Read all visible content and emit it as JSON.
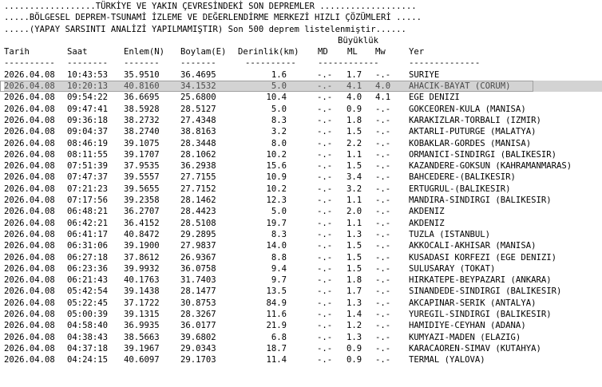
{
  "title_lines": [
    "..................TÜRKİYE VE YAKIN ÇEVRESİNDEKİ SON DEPREMLER ...................",
    ".....BÖLGESEL DEPREM-TSUNAMİ İZLEME VE DEĞERLENDİRME MERKEZİ HIZLI ÇÖZÜMLERİ .....",
    ".....(YAPAY SARSINTI ANALİZİ YAPILMAMIŞTIR) Son 500 deprem listelenmiştir......"
  ],
  "magnitude_group_label": "Büyüklük",
  "columns": {
    "date": "Tarih",
    "time": "Saat",
    "lat": "Enlem(N)",
    "lon": "Boylam(E)",
    "depth": "Derinlik(km)",
    "md": "MD",
    "ml": "ML",
    "mw": "Mw",
    "place": "Yer"
  },
  "separators": {
    "date": "----------",
    "time": "--------",
    "lat": "-------",
    "lon": "-------",
    "depth": "----------",
    "mags": "------------",
    "place": "--------------"
  },
  "selected_row_index": 1,
  "rows": [
    {
      "date": "2026.04.08",
      "time": "10:43:53",
      "lat": "35.9510",
      "lon": "36.4695",
      "depth": "1.6",
      "md": "-.-",
      "ml": "1.7",
      "mw": "-.-",
      "place": "SURIYE"
    },
    {
      "date": "2026.04.08",
      "time": "10:20:13",
      "lat": "40.8160",
      "lon": "34.1532",
      "depth": "5.0",
      "md": "-.-",
      "ml": "4.1",
      "mw": "4.0",
      "place": "AHACIK-BAYAT (CORUM)"
    },
    {
      "date": "2026.04.08",
      "time": "09:54:22",
      "lat": "36.6695",
      "lon": "25.6800",
      "depth": "10.4",
      "md": "-.-",
      "ml": "4.0",
      "mw": "4.1",
      "place": "EGE DENIZI"
    },
    {
      "date": "2026.04.08",
      "time": "09:47:41",
      "lat": "38.5928",
      "lon": "28.5127",
      "depth": "5.0",
      "md": "-.-",
      "ml": "0.9",
      "mw": "-.-",
      "place": "GOKCEOREN-KULA (MANISA)"
    },
    {
      "date": "2026.04.08",
      "time": "09:36:18",
      "lat": "38.2732",
      "lon": "27.4348",
      "depth": "8.3",
      "md": "-.-",
      "ml": "1.8",
      "mw": "-.-",
      "place": "KARAKIZLAR-TORBALI (IZMIR)"
    },
    {
      "date": "2026.04.08",
      "time": "09:04:37",
      "lat": "38.2740",
      "lon": "38.8163",
      "depth": "3.2",
      "md": "-.-",
      "ml": "1.5",
      "mw": "-.-",
      "place": "AKTARLI-PUTURGE (MALATYA)"
    },
    {
      "date": "2026.04.08",
      "time": "08:46:19",
      "lat": "39.1075",
      "lon": "28.3448",
      "depth": "8.0",
      "md": "-.-",
      "ml": "2.2",
      "mw": "-.-",
      "place": "KOBAKLAR-GORDES (MANISA)"
    },
    {
      "date": "2026.04.08",
      "time": "08:11:55",
      "lat": "39.1707",
      "lon": "28.1062",
      "depth": "10.2",
      "md": "-.-",
      "ml": "1.1",
      "mw": "-.-",
      "place": "ORMANICI-SINDIRGI (BALIKESIR)"
    },
    {
      "date": "2026.04.08",
      "time": "07:51:39",
      "lat": "37.9535",
      "lon": "36.2938",
      "depth": "15.6",
      "md": "-.-",
      "ml": "1.5",
      "mw": "-.-",
      "place": "KAZANDERE-GOKSUN (KAHRAMANMARAS)"
    },
    {
      "date": "2026.04.08",
      "time": "07:47:37",
      "lat": "39.5557",
      "lon": "27.7155",
      "depth": "10.9",
      "md": "-.-",
      "ml": "3.4",
      "mw": "-.-",
      "place": "BAHCEDERE-(BALIKESIR)"
    },
    {
      "date": "2026.04.08",
      "time": "07:21:23",
      "lat": "39.5655",
      "lon": "27.7152",
      "depth": "10.2",
      "md": "-.-",
      "ml": "3.2",
      "mw": "-.-",
      "place": "ERTUGRUL-(BALIKESIR)"
    },
    {
      "date": "2026.04.08",
      "time": "07:17:56",
      "lat": "39.2358",
      "lon": "28.1462",
      "depth": "12.3",
      "md": "-.-",
      "ml": "1.1",
      "mw": "-.-",
      "place": "MANDIRA-SINDIRGI (BALIKESIR)"
    },
    {
      "date": "2026.04.08",
      "time": "06:48:21",
      "lat": "36.2707",
      "lon": "28.4423",
      "depth": "5.0",
      "md": "-.-",
      "ml": "2.0",
      "mw": "-.-",
      "place": "AKDENIZ"
    },
    {
      "date": "2026.04.08",
      "time": "06:42:21",
      "lat": "36.4152",
      "lon": "28.5108",
      "depth": "19.7",
      "md": "-.-",
      "ml": "1.1",
      "mw": "-.-",
      "place": "AKDENIZ"
    },
    {
      "date": "2026.04.08",
      "time": "06:41:17",
      "lat": "40.8472",
      "lon": "29.2895",
      "depth": "8.3",
      "md": "-.-",
      "ml": "1.3",
      "mw": "-.-",
      "place": "TUZLA (ISTANBUL)"
    },
    {
      "date": "2026.04.08",
      "time": "06:31:06",
      "lat": "39.1900",
      "lon": "27.9837",
      "depth": "14.0",
      "md": "-.-",
      "ml": "1.5",
      "mw": "-.-",
      "place": "AKKOCALI-AKHISAR (MANISA)"
    },
    {
      "date": "2026.04.08",
      "time": "06:27:18",
      "lat": "37.8612",
      "lon": "26.9367",
      "depth": "8.8",
      "md": "-.-",
      "ml": "1.5",
      "mw": "-.-",
      "place": "KUSADASI KORFEZI (EGE DENIZI)"
    },
    {
      "date": "2026.04.08",
      "time": "06:23:36",
      "lat": "39.9932",
      "lon": "36.0758",
      "depth": "9.4",
      "md": "-.-",
      "ml": "1.5",
      "mw": "-.-",
      "place": "SULUSARAY (TOKAT)"
    },
    {
      "date": "2026.04.08",
      "time": "06:21:43",
      "lat": "40.1763",
      "lon": "31.7403",
      "depth": "9.7",
      "md": "-.-",
      "ml": "1.8",
      "mw": "-.-",
      "place": "HIRKATEPE-BEYPAZARI (ANKARA)"
    },
    {
      "date": "2026.04.08",
      "time": "05:42:54",
      "lat": "39.1438",
      "lon": "28.1477",
      "depth": "13.5",
      "md": "-.-",
      "ml": "1.7",
      "mw": "-.-",
      "place": "SINANDEDE-SINDIRGI (BALIKESIR)"
    },
    {
      "date": "2026.04.08",
      "time": "05:22:45",
      "lat": "37.1722",
      "lon": "30.8753",
      "depth": "84.9",
      "md": "-.-",
      "ml": "1.3",
      "mw": "-.-",
      "place": "AKCAPINAR-SERIK (ANTALYA)"
    },
    {
      "date": "2026.04.08",
      "time": "05:00:39",
      "lat": "39.1315",
      "lon": "28.3267",
      "depth": "11.6",
      "md": "-.-",
      "ml": "1.4",
      "mw": "-.-",
      "place": "YUREGIL-SINDIRGI (BALIKESIR)"
    },
    {
      "date": "2026.04.08",
      "time": "04:58:40",
      "lat": "36.9935",
      "lon": "36.0177",
      "depth": "21.9",
      "md": "-.-",
      "ml": "1.2",
      "mw": "-.-",
      "place": "HAMIDIYE-CEYHAN (ADANA)"
    },
    {
      "date": "2026.04.08",
      "time": "04:38:43",
      "lat": "38.5663",
      "lon": "39.6802",
      "depth": "6.8",
      "md": "-.-",
      "ml": "1.3",
      "mw": "-.-",
      "place": "KUMYAZI-MADEN (ELAZIG)"
    },
    {
      "date": "2026.04.08",
      "time": "04:37:18",
      "lat": "39.1967",
      "lon": "29.0343",
      "depth": "18.7",
      "md": "-.-",
      "ml": "0.9",
      "mw": "-.-",
      "place": "KARACAOREN-SIMAV (KUTAHYA)"
    },
    {
      "date": "2026.04.08",
      "time": "04:24:15",
      "lat": "40.6097",
      "lon": "29.1703",
      "depth": "11.4",
      "md": "-.-",
      "ml": "0.9",
      "mw": "-.-",
      "place": "TERMAL (YALOVA)"
    }
  ]
}
